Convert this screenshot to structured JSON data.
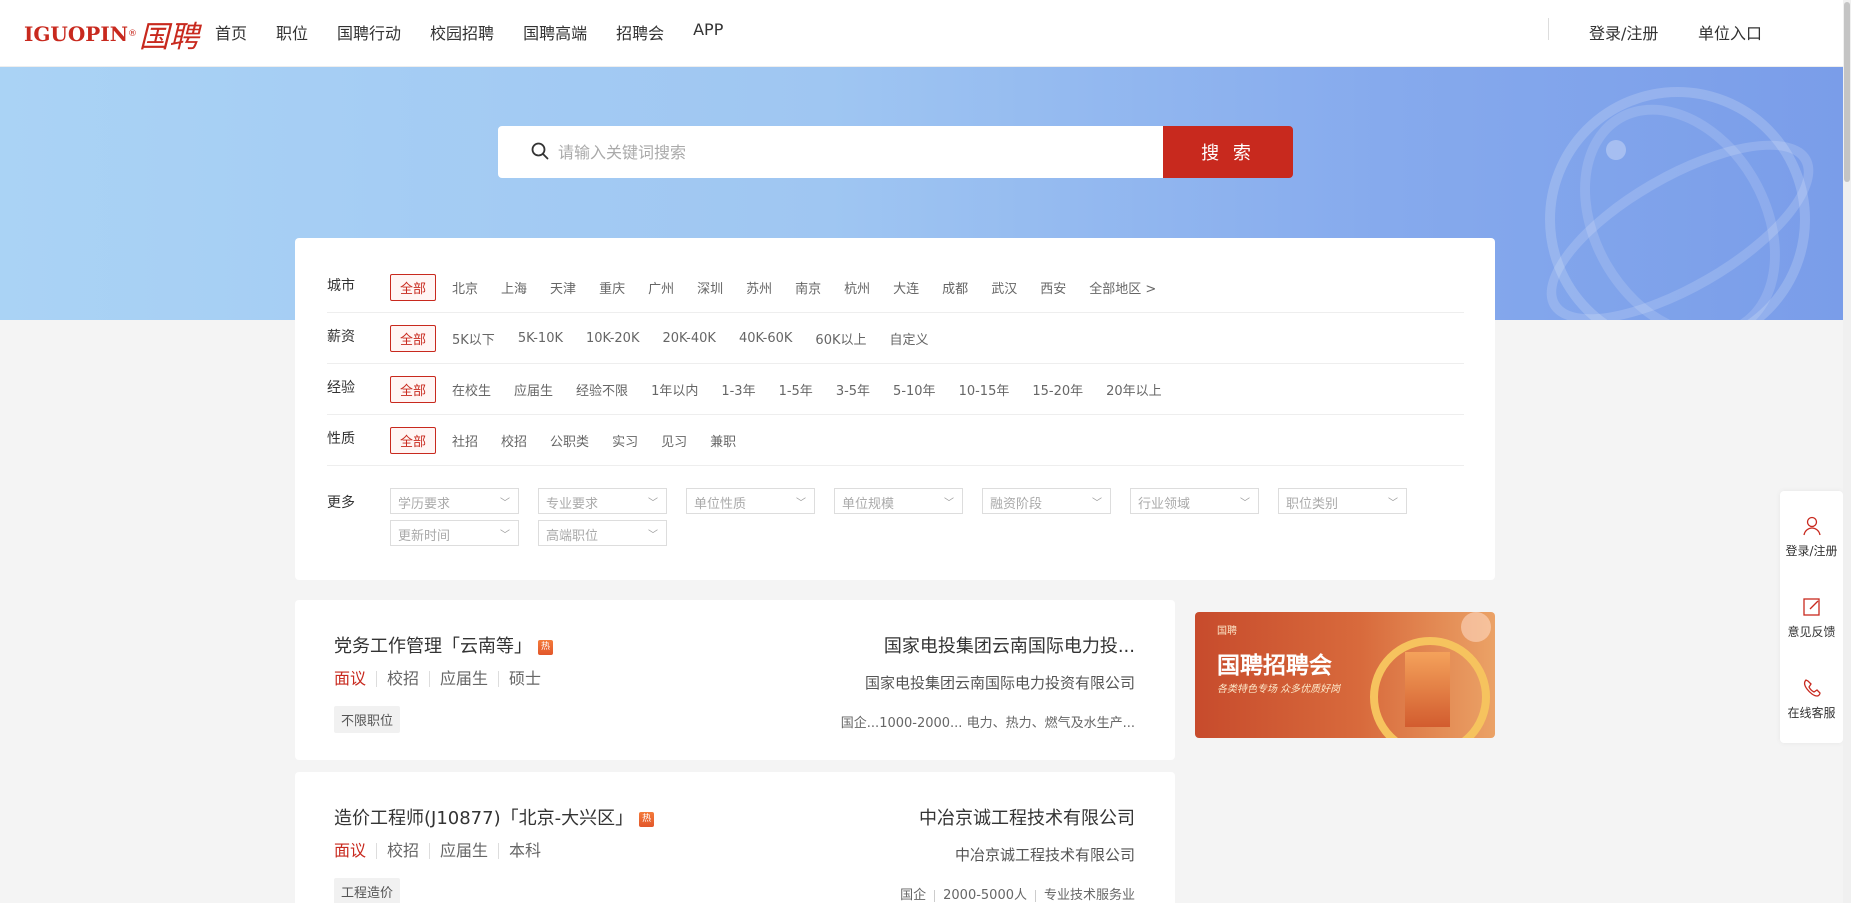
{
  "header": {
    "logo_text": "IGUOPIN",
    "logo_mark": "®",
    "logo_cn": "国聘",
    "nav": [
      "首页",
      "职位",
      "国聘行动",
      "校园招聘",
      "国聘高端",
      "招聘会",
      "APP"
    ],
    "login": "登录/注册",
    "unit_entry": "单位入口"
  },
  "search": {
    "placeholder": "请输入关键词搜索",
    "button": "搜 索"
  },
  "filters": {
    "city": {
      "label": "城市",
      "options": [
        "全部",
        "北京",
        "上海",
        "天津",
        "重庆",
        "广州",
        "深圳",
        "苏州",
        "南京",
        "杭州",
        "大连",
        "成都",
        "武汉",
        "西安",
        "全部地区 >"
      ]
    },
    "salary": {
      "label": "薪资",
      "options": [
        "全部",
        "5K以下",
        "5K-10K",
        "10K-20K",
        "20K-40K",
        "40K-60K",
        "60K以上",
        "自定义"
      ]
    },
    "experience": {
      "label": "经验",
      "options": [
        "全部",
        "在校生",
        "应届生",
        "经验不限",
        "1年以内",
        "1-3年",
        "1-5年",
        "3-5年",
        "5-10年",
        "10-15年",
        "15-20年",
        "20年以上"
      ]
    },
    "nature": {
      "label": "性质",
      "options": [
        "全部",
        "社招",
        "校招",
        "公职类",
        "实习",
        "见习",
        "兼职"
      ]
    },
    "more": {
      "label": "更多",
      "selects": [
        "学历要求",
        "专业要求",
        "单位性质",
        "单位规模",
        "融资阶段",
        "行业领域",
        "职位类别",
        "更新时间",
        "高端职位"
      ]
    }
  },
  "jobs": [
    {
      "title": "党务工作管理「云南等」",
      "hot": "热",
      "pay": "面议",
      "tags": [
        "校招",
        "应届生",
        "硕士"
      ],
      "badge": "不限职位",
      "company_head": "国家电投集团云南国际电力投...",
      "company_full": "国家电投集团云南国际电力投资有限公司",
      "company_info": [
        "国企...",
        "1000-2000...",
        "电力、热力、燃气及水生产..."
      ]
    },
    {
      "title": "造价工程师(J10877)「北京-大兴区」",
      "hot": "热",
      "pay": "面议",
      "tags": [
        "校招",
        "应届生",
        "本科"
      ],
      "badge": "工程造价",
      "company_head": "中冶京诚工程技术有限公司",
      "company_full": "中冶京诚工程技术有限公司",
      "company_info": [
        "国企",
        "2000-5000人",
        "专业技术服务业"
      ]
    }
  ],
  "ad": {
    "small": "国聘",
    "title": "国聘招聘会",
    "subtitle": "各类特色专场 众多优质好岗"
  },
  "side": {
    "items": [
      "登录/注册",
      "意见反馈",
      "在线客服"
    ]
  },
  "colors": {
    "brand_red": "#c8291e",
    "hero_blue": "#9fc6f2"
  }
}
